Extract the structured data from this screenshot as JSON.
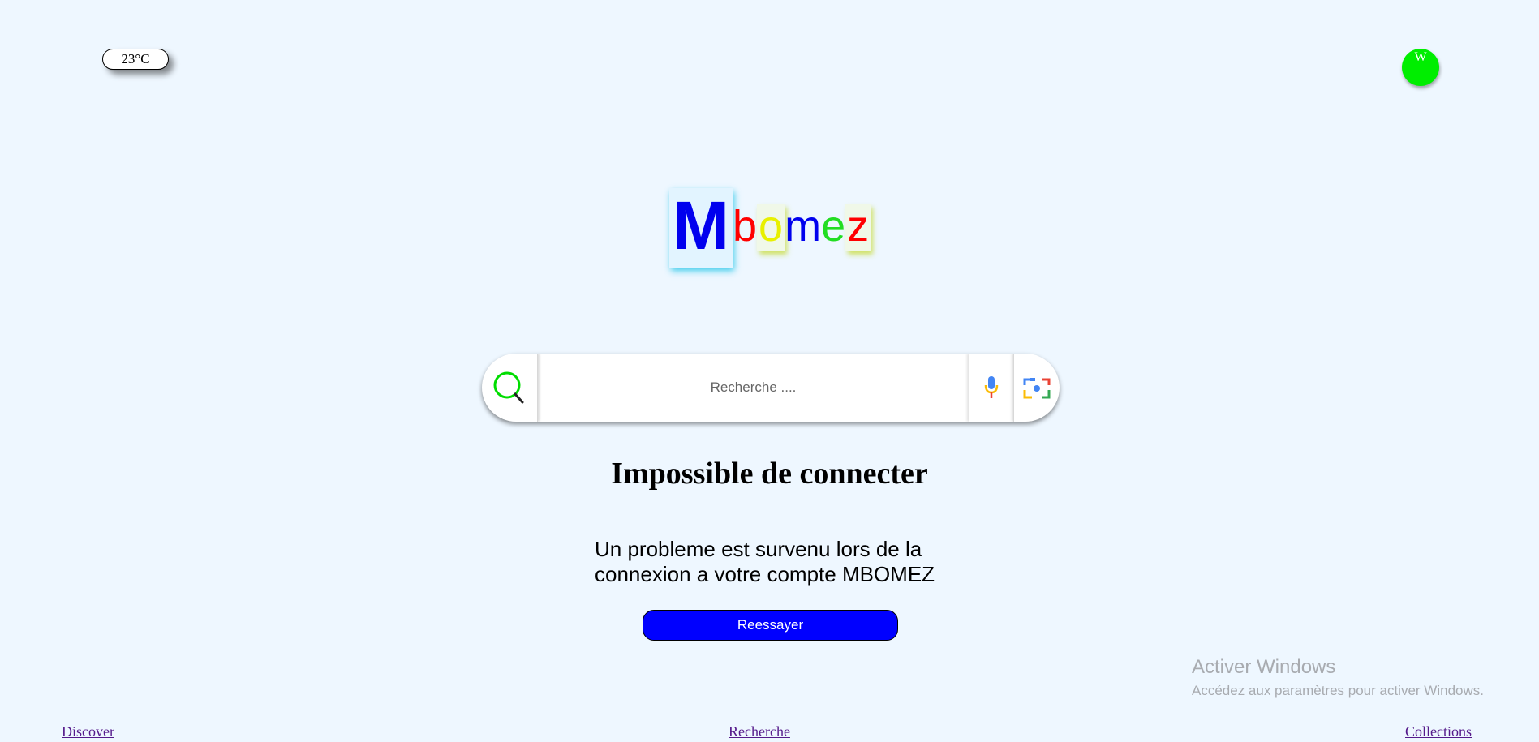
{
  "weather": {
    "temperature": "23°C"
  },
  "avatar": {
    "initial": "W",
    "color": "#00ee00"
  },
  "logo": {
    "letters": [
      {
        "char": "M",
        "color": "#0000ee"
      },
      {
        "char": "b",
        "color": "#ff0000"
      },
      {
        "char": "o",
        "color": "#e8f000"
      },
      {
        "char": "m",
        "color": "#0000ee"
      },
      {
        "char": "e",
        "color": "#22dd22"
      },
      {
        "char": "z",
        "color": "#ff0000"
      }
    ]
  },
  "search": {
    "placeholder": "Recherche ....",
    "icons": [
      "search-icon",
      "microphone-icon",
      "camera-icon"
    ]
  },
  "error": {
    "title": "Impossible de connecter",
    "message": "Un probleme est survenu lors de la connexion a votre compte MBOMEZ",
    "retry_label": "Reessayer"
  },
  "watermark": {
    "title": "Activer Windows",
    "subtitle": "Accédez aux paramètres pour activer Windows."
  },
  "footer": {
    "links": [
      "Discover",
      "Recherche",
      "Collections"
    ]
  },
  "colors": {
    "background": "#eef7ff",
    "accent_button": "#0000ff",
    "link": "#551a8b"
  }
}
